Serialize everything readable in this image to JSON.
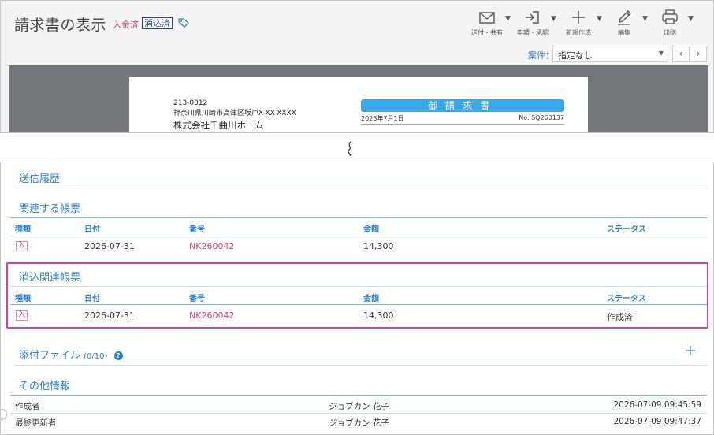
{
  "header": {
    "title": "請求書の表示",
    "badge_paid": "入金済",
    "badge_cleared": "消込済",
    "tag_icon": "tag-icon"
  },
  "toolbar": [
    {
      "label": "送付・共有",
      "icon": "envelope-icon"
    },
    {
      "label": "申請・承認",
      "icon": "submit-arrow-icon"
    },
    {
      "label": "新規作成",
      "icon": "plus-icon"
    },
    {
      "label": "編集",
      "icon": "pencil-icon"
    },
    {
      "label": "印刷",
      "icon": "printer-icon"
    }
  ],
  "case_filter": {
    "label": "案件：",
    "value": "指定なし"
  },
  "pager": {
    "prev": "‹",
    "next": "›"
  },
  "preview": {
    "postal_code": "213-0012",
    "address": "神奈川県川崎市高津区坂戸X-XX-XXXX",
    "company": "株式会社千曲川ホーム",
    "doc_heading": "御請求書",
    "doc_date": "2026年7月1日",
    "doc_no": "No. SQ260137"
  },
  "cut_mark": "≀",
  "sections": {
    "history": "送信履歴",
    "related": "関連する帳票",
    "cleared_related": "消込関連帳票",
    "attachments": "添付ファイル",
    "attachments_count": "(0/10)",
    "other": "その他情報"
  },
  "table_headers": {
    "kind": "種類",
    "date": "日付",
    "number": "番号",
    "amount": "金額",
    "status": "ステータス"
  },
  "related_rows": [
    {
      "kind": "入",
      "date": "2026-07-31",
      "number": "NK260042",
      "amount": "14,300",
      "status": ""
    }
  ],
  "cleared_rows": [
    {
      "kind": "入",
      "date": "2026-07-31",
      "number": "NK260042",
      "amount": "14,300",
      "status": "作成済"
    }
  ],
  "other_info": [
    {
      "label": "作成者",
      "name": "ジョブカン 花子",
      "time": "2026-07-09 09:45:59"
    },
    {
      "label": "最終更新者",
      "name": "ジョブカン 花子",
      "time": "2026-07-09 09:47:37"
    }
  ],
  "colors": {
    "accent": "#2f7fc5",
    "pink": "#d9466f",
    "highlight": "#e03e8c"
  }
}
